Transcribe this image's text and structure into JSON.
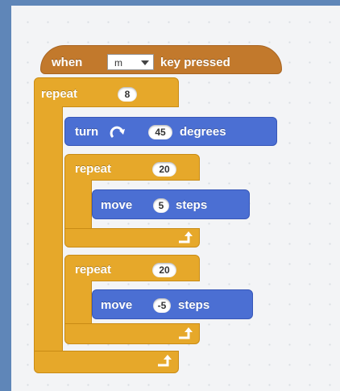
{
  "hat_block": {
    "prefix": "when",
    "key_value": "m",
    "suffix": "key pressed"
  },
  "outer_repeat": {
    "label": "repeat",
    "count": "8"
  },
  "turn_block": {
    "label": "turn",
    "value": "45",
    "suffix": "degrees",
    "icon": "rotate-clockwise-icon"
  },
  "inner_repeat_1": {
    "label": "repeat",
    "count": "20"
  },
  "move_block_1": {
    "label": "move",
    "value": "5",
    "suffix": "steps"
  },
  "inner_repeat_2": {
    "label": "repeat",
    "count": "20"
  },
  "move_block_2": {
    "label": "move",
    "value": "-5",
    "suffix": "steps"
  },
  "colors": {
    "control": "#e6a82a",
    "motion": "#4b6fd3",
    "events": "#c2792c",
    "frame": "#5f86b8"
  }
}
